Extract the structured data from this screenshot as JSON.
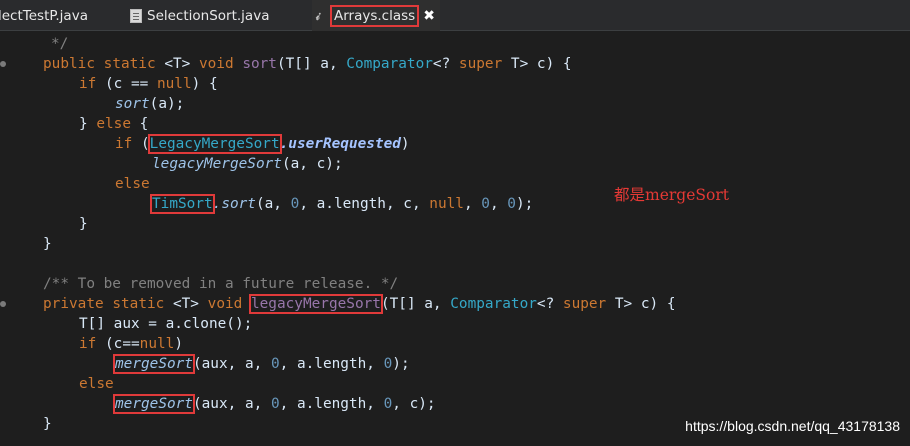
{
  "tabs": [
    {
      "label": "lectTestP.java",
      "icon": "java-file-icon",
      "active": false
    },
    {
      "label": "SelectionSort.java",
      "icon": "java-file-icon",
      "active": false
    },
    {
      "label": "Arrays.class",
      "icon": "class-file-icon",
      "active": true,
      "close": "✖"
    }
  ],
  "code": {
    "l0_comment_end": "*/",
    "l1": {
      "kw1": "public",
      "kw2": "static",
      "tparam": "<T>",
      "kw3": "void",
      "name": "sort",
      "p1": "(T[] a, ",
      "ptype": "Comparator",
      "p2": "<? ",
      "sup": "super",
      "p3": " T> c) {"
    },
    "l2": {
      "kw": "if",
      "a": " (c == ",
      "nul": "null",
      "b": ") {"
    },
    "l3": {
      "call": "sort",
      "args": "(a);"
    },
    "l4": {
      "a": "} ",
      "kw": "else",
      "b": " {"
    },
    "l5": {
      "kw": "if",
      "a": " (",
      "type": "LegacyMergeSort",
      "field": ".userRequested",
      "b": ")"
    },
    "l6": {
      "call": "legacyMergeSort",
      "args": "(a, c);"
    },
    "l7": {
      "kw": "else"
    },
    "l8": {
      "type": "TimSort",
      "call": ".sort",
      "a": "(a, ",
      "n0": "0",
      "b": ", a.length, c, ",
      "nul": "null",
      "c": ", ",
      "n1": "0",
      "d": ", ",
      "n2": "0",
      "e": ");"
    },
    "l9": "}",
    "l10": "}",
    "l11_comment": "/** To be removed in a future release. */",
    "l12": {
      "kw1": "private",
      "kw2": "static",
      "tparam": "<T>",
      "kw3": "void",
      "name": "legacyMergeSort",
      "p1": "(T[] a, ",
      "ptype": "Comparator",
      "p2": "<? ",
      "sup": "super",
      "p3": " T> c) {"
    },
    "l13": {
      "a": "T[] aux = a.clone();"
    },
    "l14": {
      "kw": "if",
      "a": " (c==",
      "nul": "null",
      "b": ")"
    },
    "l15": {
      "call": "mergeSort",
      "a": "(aux, a, ",
      "n0": "0",
      "b": ", a.length, ",
      "n1": "0",
      "c": ");"
    },
    "l16": {
      "kw": "else"
    },
    "l17": {
      "call": "mergeSort",
      "a": "(aux, a, ",
      "n0": "0",
      "b": ", a.length, ",
      "n1": "0",
      "c": ", c);"
    },
    "l18": "}"
  },
  "annotation": "都是mergeSort",
  "watermark": "https://blog.csdn.net/qq_43178138",
  "colors": {
    "annotation": "#e53935",
    "highlight_box": "#e03a3a",
    "keyword": "#cc7832",
    "type": "#35a8c8"
  }
}
